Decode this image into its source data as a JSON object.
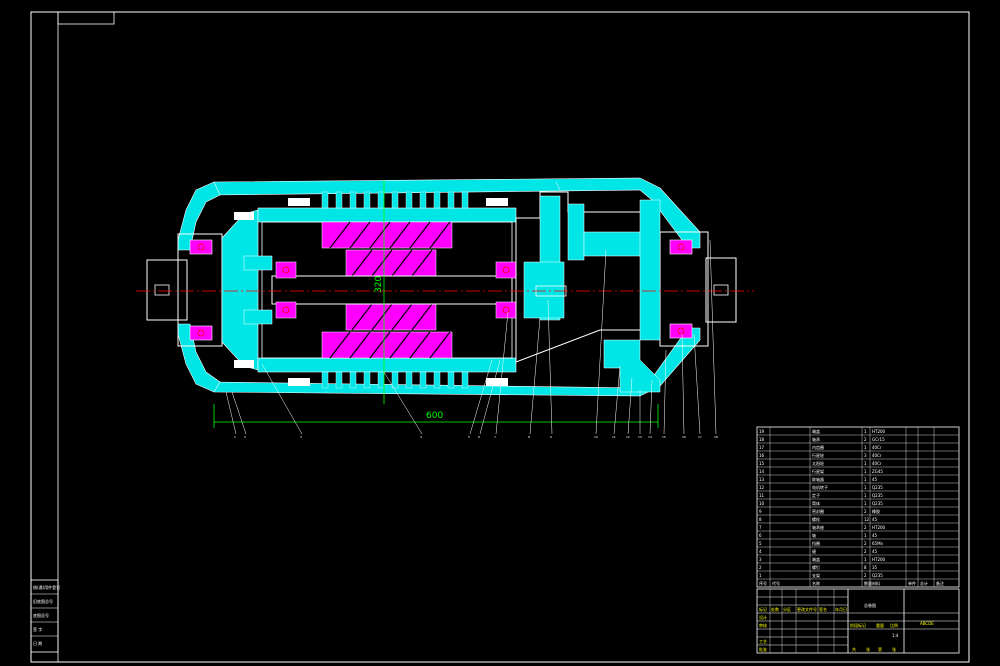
{
  "drawing": {
    "title": "总装图",
    "drawing_no": "ABCDE",
    "dim_length": "600",
    "dim_diameter": "320",
    "colors": {
      "background": "#000000",
      "outline": "#ffffff",
      "section": "#00ffff",
      "hatch": "#ff00ff",
      "dimension": "#00ff00",
      "centerline": "#ff0000",
      "label": "#ffff00"
    }
  },
  "parts_list": {
    "header": [
      "序号",
      "代号",
      "名称",
      "数量",
      "材料",
      "单件",
      "总计",
      "备注"
    ],
    "rows": [
      {
        "no": "19",
        "name": "端盖",
        "qty": "1",
        "material": "HT200"
      },
      {
        "no": "18",
        "name": "轴承",
        "qty": "2",
        "material": "GCr15"
      },
      {
        "no": "17",
        "name": "内齿圈",
        "qty": "1",
        "material": "40Cr"
      },
      {
        "no": "16",
        "name": "行星轮",
        "qty": "3",
        "material": "40Cr"
      },
      {
        "no": "15",
        "name": "太阳轮",
        "qty": "1",
        "material": "40Cr"
      },
      {
        "no": "14",
        "name": "行星架",
        "qty": "1",
        "material": "ZG45"
      },
      {
        "no": "13",
        "name": "联轴器",
        "qty": "1",
        "material": "45"
      },
      {
        "no": "12",
        "name": "电机转子",
        "qty": "1",
        "material": "Q235"
      },
      {
        "no": "11",
        "name": "定子",
        "qty": "1",
        "material": "Q235"
      },
      {
        "no": "10",
        "name": "筒体",
        "qty": "1",
        "material": "Q235"
      },
      {
        "no": "9",
        "name": "密封圈",
        "qty": "2",
        "material": "橡胶"
      },
      {
        "no": "8",
        "name": "螺栓",
        "qty": "12",
        "material": "45"
      },
      {
        "no": "7",
        "name": "轴承座",
        "qty": "2",
        "material": "HT200"
      },
      {
        "no": "6",
        "name": "轴",
        "qty": "1",
        "material": "45"
      },
      {
        "no": "5",
        "name": "挡圈",
        "qty": "2",
        "material": "65Mn"
      },
      {
        "no": "4",
        "name": "键",
        "qty": "2",
        "material": "45"
      },
      {
        "no": "3",
        "name": "端盖",
        "qty": "1",
        "material": "HT200"
      },
      {
        "no": "2",
        "name": "螺钉",
        "qty": "8",
        "material": "35"
      },
      {
        "no": "1",
        "name": "支架",
        "qty": "2",
        "material": "Q235"
      }
    ]
  },
  "title_block": {
    "row_labels": [
      "设计",
      "审核",
      "工艺",
      "批准"
    ],
    "cols": [
      "标记",
      "处数",
      "分区",
      "更改文件号",
      "签名",
      "年月日"
    ],
    "stage_labels": [
      "阶段标记",
      "重量",
      "比例"
    ],
    "scale": "1:4",
    "sheet": [
      "共",
      "张",
      "第",
      "张"
    ]
  },
  "side_block": {
    "lines": [
      "借(通)用件登记",
      "旧底图总号",
      "底图总号",
      "签 字",
      "日 期"
    ]
  },
  "callouts": [
    "1",
    "2",
    "3",
    "4",
    "5",
    "6",
    "7",
    "8",
    "9",
    "10",
    "11",
    "12",
    "13",
    "14",
    "15",
    "16",
    "17",
    "18",
    "19"
  ]
}
